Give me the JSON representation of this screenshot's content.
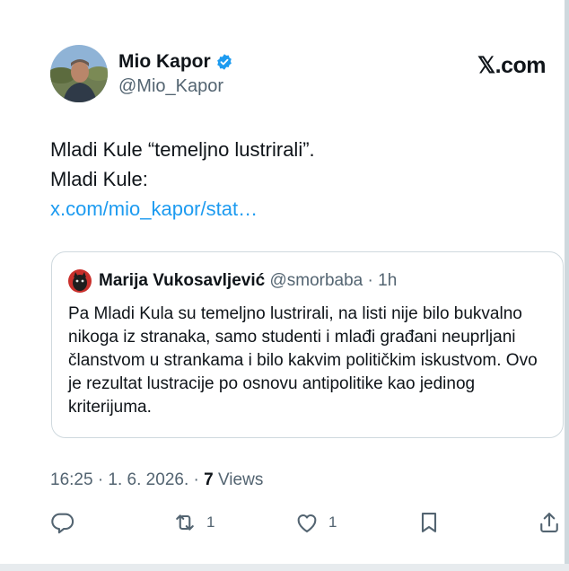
{
  "tweet": {
    "display_name": "Mio Kapor",
    "handle": "@Mio_Kapor",
    "logo_text": "𝕏.com",
    "lines": [
      "Mladi Kule “temeljno lustrirali”.",
      "Mladi Kule:"
    ],
    "link_text": "x.com/mio_kapor/stat…"
  },
  "quote": {
    "name": "Marija Vukosavljević",
    "handle_time": "@smorbaba · 1h",
    "text": "Pa Mladi Kula su temeljno lustrirali, na listi nije bilo bukvalno nikoga iz stranaka, samo studenti i mlađi građani neuprljani članstvom u strankama i bilo kakvim političkim iskustvom. Ovo je rezultat lustracije po osnovu antipolitike kao jedinog kriterijuma."
  },
  "meta": {
    "datetime": "16:25 · 1. 6. 2026. · ",
    "views_count": "7",
    "views_label": " Views"
  },
  "actions": {
    "reply_icon": "reply-icon",
    "retweet_icon": "retweet-icon",
    "retweet_count": "1",
    "like_icon": "heart-icon",
    "like_count": "1",
    "bookmark_icon": "bookmark-icon",
    "share_icon": "share-icon"
  },
  "colors": {
    "accent": "#1d9bf0",
    "text": "#0f1419",
    "secondary": "#536471",
    "border": "#cfd9de"
  }
}
